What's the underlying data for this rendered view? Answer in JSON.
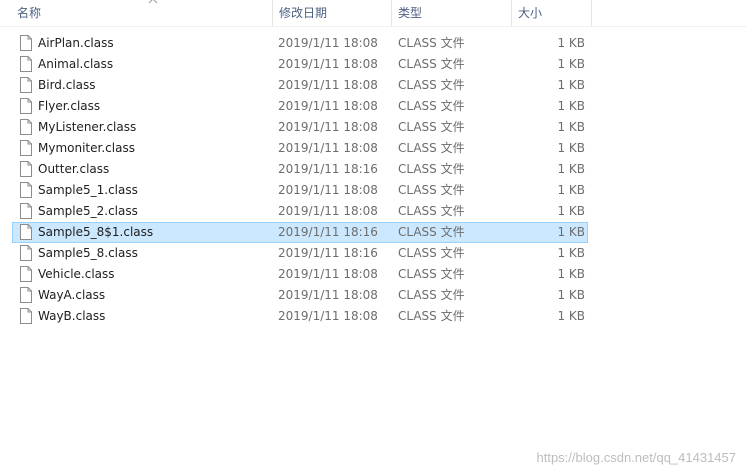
{
  "columns": {
    "name": "名称",
    "date": "修改日期",
    "type": "类型",
    "size": "大小"
  },
  "sort_icon": "chevron-up-icon",
  "file_icon": "document-icon",
  "files": [
    {
      "name": "AirPlan.class",
      "date": "2019/1/11 18:08",
      "type": "CLASS 文件",
      "size": "1 KB"
    },
    {
      "name": "Animal.class",
      "date": "2019/1/11 18:08",
      "type": "CLASS 文件",
      "size": "1 KB"
    },
    {
      "name": "Bird.class",
      "date": "2019/1/11 18:08",
      "type": "CLASS 文件",
      "size": "1 KB"
    },
    {
      "name": "Flyer.class",
      "date": "2019/1/11 18:08",
      "type": "CLASS 文件",
      "size": "1 KB"
    },
    {
      "name": "MyListener.class",
      "date": "2019/1/11 18:08",
      "type": "CLASS 文件",
      "size": "1 KB"
    },
    {
      "name": "Mymoniter.class",
      "date": "2019/1/11 18:08",
      "type": "CLASS 文件",
      "size": "1 KB"
    },
    {
      "name": "Outter.class",
      "date": "2019/1/11 18:16",
      "type": "CLASS 文件",
      "size": "1 KB"
    },
    {
      "name": "Sample5_1.class",
      "date": "2019/1/11 18:08",
      "type": "CLASS 文件",
      "size": "1 KB"
    },
    {
      "name": "Sample5_2.class",
      "date": "2019/1/11 18:08",
      "type": "CLASS 文件",
      "size": "1 KB"
    },
    {
      "name": "Sample5_8$1.class",
      "date": "2019/1/11 18:16",
      "type": "CLASS 文件",
      "size": "1 KB",
      "selected": true
    },
    {
      "name": "Sample5_8.class",
      "date": "2019/1/11 18:16",
      "type": "CLASS 文件",
      "size": "1 KB"
    },
    {
      "name": "Vehicle.class",
      "date": "2019/1/11 18:08",
      "type": "CLASS 文件",
      "size": "1 KB"
    },
    {
      "name": "WayA.class",
      "date": "2019/1/11 18:08",
      "type": "CLASS 文件",
      "size": "1 KB"
    },
    {
      "name": "WayB.class",
      "date": "2019/1/11 18:08",
      "type": "CLASS 文件",
      "size": "1 KB"
    }
  ],
  "watermark": "https://blog.csdn.net/qq_41431457",
  "colors": {
    "selection_bg": "#cce8ff",
    "selection_border": "#99d1ff",
    "header_text": "#4d6082"
  }
}
